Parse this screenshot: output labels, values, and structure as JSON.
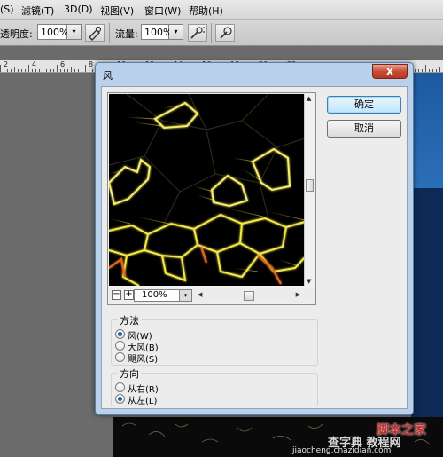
{
  "menubar": {
    "items": [
      "(S)",
      "滤镜(T)",
      "3D(D)",
      "视图(V)",
      "窗口(W)",
      "帮助(H)"
    ]
  },
  "options": {
    "opacity_label": "透明度:",
    "opacity_value": "100%",
    "flow_label": "流量:",
    "flow_value": "100%"
  },
  "ruler": {
    "labels": [
      "2",
      "4",
      "6",
      "8",
      "10",
      "12",
      "14",
      "16",
      "18",
      "20",
      "22"
    ]
  },
  "dialog": {
    "title": "风",
    "close_label": "x",
    "ok_label": "确定",
    "cancel_label": "取消",
    "zoom_value": "100%",
    "zoom_minus": "−",
    "zoom_plus": "+",
    "method_legend": "方法",
    "method_options": [
      {
        "label": "风(W)",
        "selected": true
      },
      {
        "label": "大风(B)",
        "selected": false
      },
      {
        "label": "飓风(S)",
        "selected": false
      }
    ],
    "direction_legend": "方向",
    "direction_options": [
      {
        "label": "从右(R)",
        "selected": false
      },
      {
        "label": "从左(L)",
        "selected": true
      }
    ]
  },
  "watermark": {
    "text1": "查字典 教程网",
    "text2": "jiaocheng.chazidian.com",
    "logo": "脚本之家"
  },
  "colors": {
    "dialog_frame": "#b9d1ea",
    "default_button": "#bee6fd",
    "glow_yellow": "#f4e84a",
    "glow_orange": "#e06a1c"
  }
}
